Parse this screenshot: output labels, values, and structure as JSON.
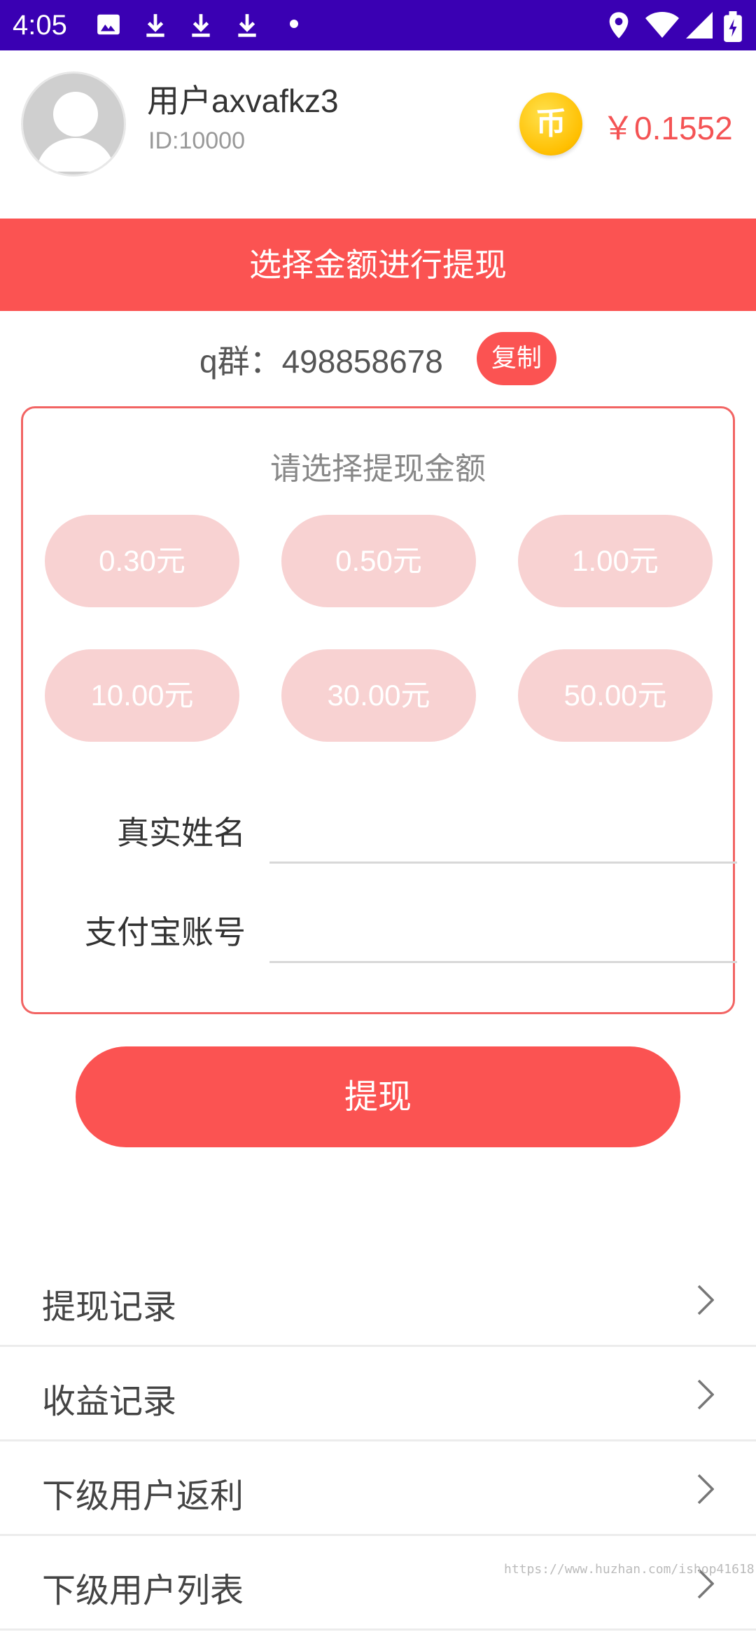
{
  "status_bar": {
    "time": "4:05",
    "left_icons": [
      "image-icon",
      "download-icon",
      "download-icon",
      "download-icon",
      "dot-icon"
    ],
    "right_icons": [
      "location-icon",
      "wifi-icon",
      "signal-icon",
      "battery-icon"
    ]
  },
  "header": {
    "username": "用户axvafkz3",
    "user_id": "ID:10000",
    "coin_glyph": "币",
    "balance": "￥0.1552"
  },
  "banner": {
    "title": "选择金额进行提现"
  },
  "qq_group": {
    "text": "q群：498858678",
    "copy_label": "复制"
  },
  "withdraw_card": {
    "title": "请选择提现金额",
    "amounts": [
      "0.30元",
      "0.50元",
      "1.00元",
      "10.00元",
      "30.00元",
      "50.00元"
    ],
    "real_name_label": "真实姓名",
    "real_name_value": "",
    "alipay_label": "支付宝账号",
    "alipay_value": ""
  },
  "withdraw_button": {
    "label": "提现"
  },
  "menu": {
    "items": [
      "提现记录",
      "收益记录",
      "下级用户返利",
      "下级用户列表"
    ]
  },
  "watermark": "https://www.huzhan.com/ishop41618",
  "colors": {
    "primary": "#fb5352",
    "amount_bg": "#f8d2d2",
    "status_bar": "#3a00b3",
    "coin": "#ffbf00"
  }
}
